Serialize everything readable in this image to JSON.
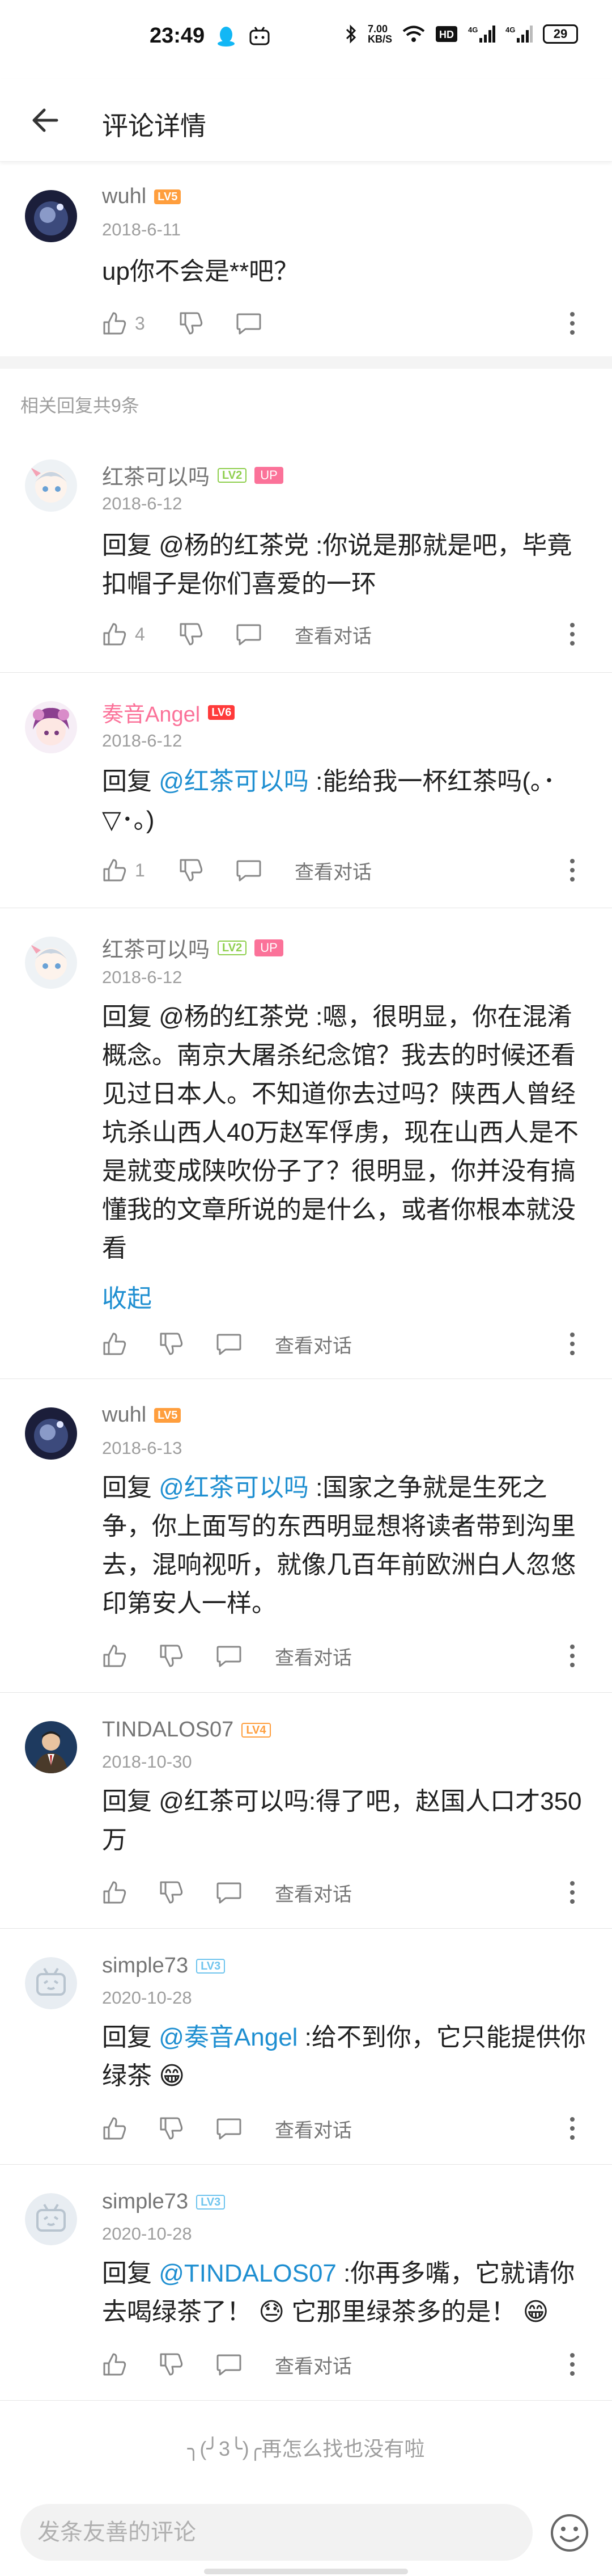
{
  "status": {
    "time": "23:49",
    "network_speed": "7.00\nKB/S",
    "battery": "29"
  },
  "header": {
    "title": "评论详情"
  },
  "root_comment": {
    "user": "wuhl",
    "level": "LV5",
    "date": "2018-6-11",
    "text": "up你不会是**吧？",
    "likes": "3"
  },
  "replies_label": "相关回复共9条",
  "replies": [
    {
      "user": "红茶可以吗",
      "level": "LV2",
      "tag": "UP",
      "date": "2018-6-12",
      "text": "回复 @杨的红茶党 :你说是那就是吧，毕竟扣帽子是你们喜爱的一环",
      "likes": "4",
      "view_label": "查看对话"
    },
    {
      "user": "奏音Angel",
      "level": "LV6",
      "date": "2018-6-12",
      "reply_prefix": "回复 ",
      "mention": "@红茶可以吗",
      "text_rest": " :能给我一杯红茶吗(｡･▽･｡)",
      "likes": "1",
      "view_label": "查看对话"
    },
    {
      "user": "红茶可以吗",
      "level": "LV2",
      "tag": "UP",
      "date": "2018-6-12",
      "text": "回复 @杨的红茶党 :嗯，很明显，你在混淆概念。南京大屠杀纪念馆？我去的时候还看见过日本人。不知道你去过吗？陕西人曾经坑杀山西人40万赵军俘虏，现在山西人是不是就变成陕吹份子了？很明显，你并没有搞懂我的文章所说的是什么，或者你根本就没看",
      "fold_label": "收起",
      "view_label": "查看对话"
    },
    {
      "user": "wuhl",
      "level": "LV5",
      "date": "2018-6-13",
      "reply_prefix": "回复 ",
      "mention": "@红茶可以吗",
      "text_rest": " :国家之争就是生死之争，你上面写的东西明显想将读者带到沟里去，混响视听，就像几百年前欧洲白人忽悠印第安人一样。",
      "view_label": "查看对话"
    },
    {
      "user": "TINDALOS07",
      "level": "LV4",
      "date": "2018-10-30",
      "text": "回复 @红茶可以吗:得了吧，赵国人口才350万",
      "view_label": "查看对话"
    },
    {
      "user": "simple73",
      "level": "LV3",
      "date": "2020-10-28",
      "reply_prefix": "回复 ",
      "mention": "@奏音Angel",
      "text_rest": " :给不到你，它只能提供你绿茶 😁",
      "view_label": "查看对话"
    },
    {
      "user": "simple73",
      "level": "LV3",
      "date": "2020-10-28",
      "reply_prefix": "回复 ",
      "mention": "@TINDALOS07",
      "text_rest": " :你再多嘴，它就请你去喝绿茶了！ 😓 它那里绿茶多的是！ 😁",
      "view_label": "查看对话"
    }
  ],
  "end_text": "╮(╯3╰)╭再怎么找也没有啦",
  "input": {
    "placeholder": "发条友善的评论"
  },
  "colors": {
    "accent_pink": "#fb7299",
    "link_blue": "#1f8fd1",
    "text_gray": "#9e9e9e"
  }
}
